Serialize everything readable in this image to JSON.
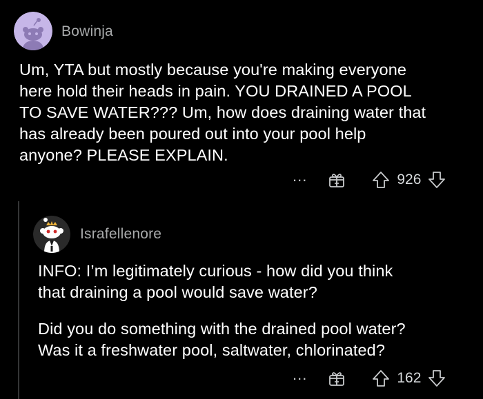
{
  "comments": [
    {
      "username": "Bowinja",
      "avatar_icon": "snoo-avatar-purple",
      "body": "Um, YTA but mostly because you're making everyone\nhere hold their heads in pain.  YOU DRAINED A POOL\nTO SAVE WATER???  Um, how does draining water that\nhas already been poured out into your pool help\nanyone?  PLEASE EXPLAIN.",
      "more": "...",
      "score": "926"
    },
    {
      "username": "Israfellenore",
      "avatar_icon": "snoo-avatar-crown",
      "paragraph_1": "INFO: I’m legitimately curious - how did you think\nthat draining a pool would save water?",
      "paragraph_2": "Did you do something with the drained pool water?\nWas it a freshwater pool, saltwater, chlorinated?",
      "more": "...",
      "score": "162"
    }
  ],
  "colors": {
    "background": "#000000",
    "text": "#ffffff",
    "username": "#a8aaab",
    "icons": "#c9cbcd",
    "avatar_bg_1": "#c6b6e8",
    "avatar_bg_2": "#2a2a2a"
  }
}
